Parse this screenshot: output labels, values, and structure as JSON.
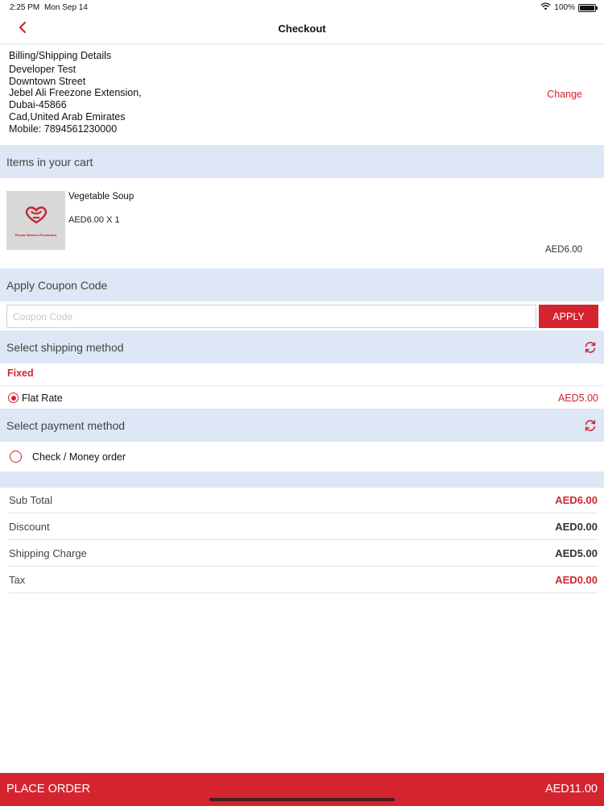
{
  "status_bar": {
    "time": "2:25 PM",
    "date": "Mon Sep 14",
    "battery": "100%",
    "battery_level": 1.0,
    "wifi_icon": "wifi-icon"
  },
  "nav": {
    "title": "Checkout",
    "back_icon": "chevron-left-icon"
  },
  "billing": {
    "heading": "Billing/Shipping Details",
    "lines": [
      "Developer Test",
      "Downtown Street",
      "Jebel Ali Freezone Extension,",
      "Dubai-45866",
      "Cad,United Arab Emirates",
      "Mobile: 7894561230000"
    ],
    "change_label": "Change"
  },
  "cart": {
    "header": "Items in your cart",
    "items": [
      {
        "name": "Vegetable Soup",
        "price_qty": "AED6.00 X 1",
        "line_total": "AED6.00",
        "thumb_brand": "Biryani Bhavan Restaurant"
      }
    ]
  },
  "coupon": {
    "header": "Apply Coupon Code",
    "placeholder": "Coupon Code",
    "value": "",
    "apply_label": "APPLY"
  },
  "shipping": {
    "header": "Select shipping method",
    "group": "Fixed",
    "options": [
      {
        "label": "Flat Rate",
        "price": "AED5.00",
        "selected": true
      }
    ],
    "refresh_icon": "refresh-icon"
  },
  "payment": {
    "header": "Select payment method",
    "options": [
      {
        "label": "Check / Money order",
        "selected": false
      }
    ],
    "refresh_icon": "refresh-icon"
  },
  "summary": [
    {
      "label": "Sub Total",
      "value": "AED6.00",
      "highlight": true
    },
    {
      "label": "Discount",
      "value": "AED0.00",
      "highlight": false
    },
    {
      "label": "Shipping Charge",
      "value": "AED5.00",
      "highlight": false
    },
    {
      "label": "Tax",
      "value": "AED0.00",
      "highlight": true
    }
  ],
  "footer": {
    "place_order_label": "PLACE ORDER",
    "total": "AED11.00"
  },
  "colors": {
    "accent": "#d4242f",
    "section_bg": "#dde7f6"
  }
}
